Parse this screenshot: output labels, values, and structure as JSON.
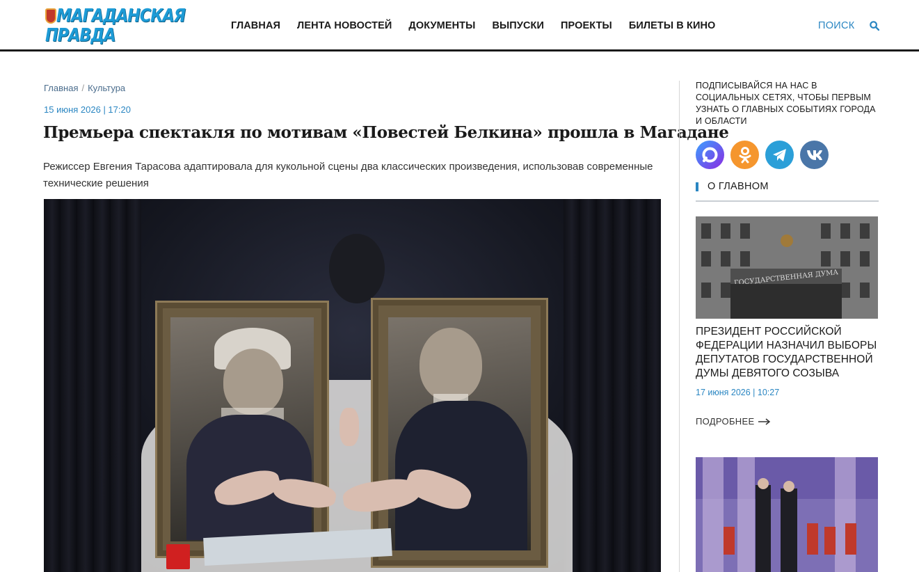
{
  "header": {
    "logo_line1": "МАГАДАНСКАЯ",
    "logo_line2": "ПРАВДА",
    "nav": [
      "ГЛАВНАЯ",
      "ЛЕНТА НОВОСТЕЙ",
      "ДОКУМЕНТЫ",
      "ВЫПУСКИ",
      "ПРОЕКТЫ",
      "БИЛЕТЫ В КИНО"
    ],
    "search_label": "ПОИСК",
    "search_icon": "search-icon"
  },
  "article": {
    "breadcrumb": [
      "Главная",
      "Культура"
    ],
    "breadcrumb_sep": "/",
    "date": "15 июня 2026 | 17:20",
    "title": "Премьера спектакля по мотивам «Повестей Белкина» прошла в Магадане",
    "lead": "Режиссер Евгения Тарасова адаптировала для кукольной сцены два классических произведения, использовав современные технические решения"
  },
  "sidebar": {
    "subscribe_text": "ПОДПИСЫВАЙСЯ НА НАС В СОЦИАЛЬНЫХ СЕТЯХ, ЧТОБЫ ПЕРВЫМ УЗНАТЬ О ГЛАВНЫХ СОБЫТИЯХ ГОРОДА И ОБЛАСТИ",
    "socials": [
      {
        "name": "max-icon",
        "color": "#6a3df2"
      },
      {
        "name": "odnoklassniki-icon",
        "color": "#f5962e"
      },
      {
        "name": "telegram-icon",
        "color": "#2b9fd8"
      },
      {
        "name": "vk-icon",
        "color": "#4a76a8"
      }
    ],
    "section_title": "О ГЛАВНОМ",
    "news": [
      {
        "title": "ПРЕЗИДЕНТ РОССИЙСКОЙ ФЕДЕРАЦИИ НАЗНАЧИЛ ВЫБОРЫ ДЕПУТАТОВ ГОСУДАРСТВЕННОЙ ДУМЫ ДЕВЯТОГО СОЗЫВА",
        "date": "17 июня 2026 | 10:27",
        "sign_text": "ГОСУДАРСТВЕННАЯ ДУМА"
      }
    ],
    "more_label": "ПОДРОБНЕЕ"
  },
  "colors": {
    "accent": "#2a86c2",
    "logo": "#1d9bd6",
    "header_border": "#1a1a1a"
  }
}
